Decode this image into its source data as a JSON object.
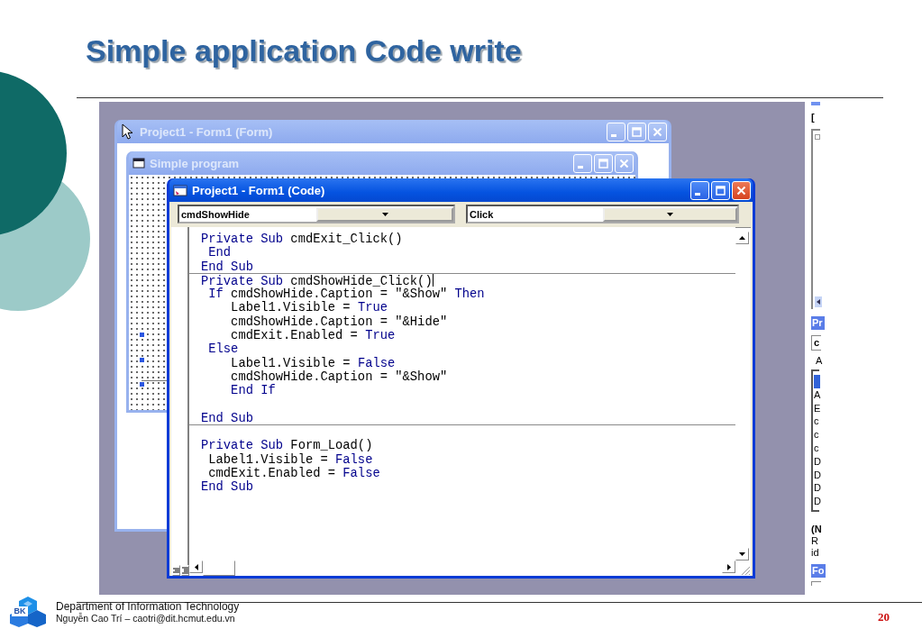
{
  "slide": {
    "title": "Simple application Code write",
    "page_number": "20"
  },
  "windows": [
    {
      "kind": "designer",
      "title": "Project1 - Form1 (Form)",
      "active": false
    },
    {
      "kind": "form",
      "title": "Simple program",
      "active": false
    },
    {
      "kind": "code",
      "title": "Project1 - Form1 (Code)",
      "active": true
    }
  ],
  "code_window": {
    "object_combo": "cmdShowHide",
    "procedure_combo": "Click",
    "lines": [
      {
        "kind": "code",
        "caret": false,
        "segments": [
          {
            "text": "Private Sub",
            "keyword": true
          },
          {
            "text": " cmdExit_Click()",
            "keyword": false
          }
        ]
      },
      {
        "kind": "code",
        "caret": false,
        "segments": [
          {
            "text": " End",
            "keyword": true
          }
        ]
      },
      {
        "kind": "code",
        "caret": false,
        "segments": [
          {
            "text": "End Sub",
            "keyword": true
          }
        ]
      },
      {
        "kind": "separator"
      },
      {
        "kind": "code",
        "caret": true,
        "segments": [
          {
            "text": "Private Sub",
            "keyword": true
          },
          {
            "text": " cmdShowHide_Click()",
            "keyword": false
          }
        ]
      },
      {
        "kind": "code",
        "caret": false,
        "segments": [
          {
            "text": " If",
            "keyword": true
          },
          {
            "text": " cmdShowHide.Caption = \"&Show\" ",
            "keyword": false
          },
          {
            "text": "Then",
            "keyword": true
          }
        ]
      },
      {
        "kind": "code",
        "caret": false,
        "segments": [
          {
            "text": "    Label1.Visible = ",
            "keyword": false
          },
          {
            "text": "True",
            "keyword": true
          }
        ]
      },
      {
        "kind": "code",
        "caret": false,
        "segments": [
          {
            "text": "    cmdShowHide.Caption = \"&Hide\"",
            "keyword": false
          }
        ]
      },
      {
        "kind": "code",
        "caret": false,
        "segments": [
          {
            "text": "    cmdExit.Enabled = ",
            "keyword": false
          },
          {
            "text": "True",
            "keyword": true
          }
        ]
      },
      {
        "kind": "code",
        "caret": false,
        "segments": [
          {
            "text": " Else",
            "keyword": true
          }
        ]
      },
      {
        "kind": "code",
        "caret": false,
        "segments": [
          {
            "text": "    Label1.Visible = ",
            "keyword": false
          },
          {
            "text": "False",
            "keyword": true
          }
        ]
      },
      {
        "kind": "code",
        "caret": false,
        "segments": [
          {
            "text": "    cmdShowHide.Caption = \"&Show\"",
            "keyword": false
          }
        ]
      },
      {
        "kind": "code",
        "caret": false,
        "segments": [
          {
            "text": "    End If",
            "keyword": true
          }
        ]
      },
      {
        "kind": "blank"
      },
      {
        "kind": "code",
        "caret": false,
        "segments": [
          {
            "text": "End Sub",
            "keyword": true
          }
        ]
      },
      {
        "kind": "separator"
      },
      {
        "kind": "blank"
      },
      {
        "kind": "code",
        "caret": false,
        "segments": [
          {
            "text": "Private Sub",
            "keyword": true
          },
          {
            "text": " Form_Load()",
            "keyword": false
          }
        ]
      },
      {
        "kind": "code",
        "caret": false,
        "segments": [
          {
            "text": " Label1.Visible = ",
            "keyword": false
          },
          {
            "text": "False",
            "keyword": true
          }
        ]
      },
      {
        "kind": "code",
        "caret": false,
        "segments": [
          {
            "text": " cmdExit.Enabled = ",
            "keyword": false
          },
          {
            "text": "False",
            "keyword": true
          }
        ]
      },
      {
        "kind": "code",
        "caret": false,
        "segments": [
          {
            "text": "End Sub",
            "keyword": true
          }
        ]
      }
    ]
  },
  "side_panel": {
    "top_glyph": "[",
    "properties_title": "Pr",
    "object_field": "c",
    "tab_label": "A",
    "property_rows": [
      {
        "selected": true
      },
      {
        "name": "A",
        "selected": false
      },
      {
        "name": "E",
        "selected": false
      },
      {
        "name": "c",
        "selected": false
      },
      {
        "name": "c",
        "selected": false
      },
      {
        "name": "c",
        "selected": false
      },
      {
        "name": "D",
        "selected": false
      },
      {
        "name": "D",
        "selected": false
      },
      {
        "name": "D",
        "selected": false
      },
      {
        "name": "D",
        "selected": false
      }
    ],
    "description_title": "(N",
    "description_lines": [
      "R",
      "id"
    ],
    "next_title": "Fo"
  },
  "footer": {
    "logo_text": "BK",
    "department": "Department of Information Technology",
    "author": "Nguyễn Cao Trí – caotri@dit.hcmut.edu.vn"
  }
}
